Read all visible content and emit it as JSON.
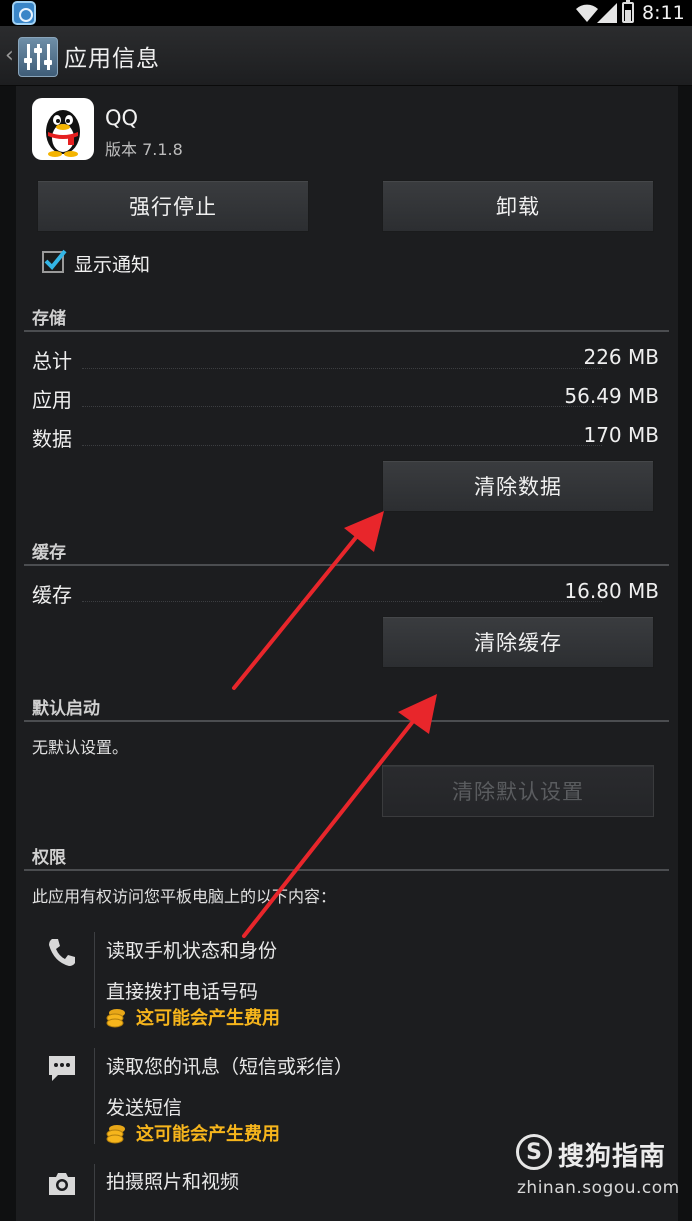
{
  "status_bar": {
    "time": "8:11"
  },
  "action_bar": {
    "title": "应用信息"
  },
  "app": {
    "name": "QQ",
    "version": "版本 7.1.8"
  },
  "buttons": {
    "force_stop": "强行停止",
    "uninstall": "卸载",
    "clear_data": "清除数据",
    "clear_cache": "清除缓存",
    "clear_defaults": "清除默认设置"
  },
  "notification": {
    "label": "显示通知",
    "checked": true
  },
  "storage": {
    "header": "存储",
    "rows": [
      {
        "label": "总计",
        "value": "226 MB"
      },
      {
        "label": "应用",
        "value": "56.49 MB"
      },
      {
        "label": "数据",
        "value": "170 MB"
      }
    ]
  },
  "cache": {
    "header": "缓存",
    "label": "缓存",
    "value": "16.80 MB"
  },
  "default_launch": {
    "header": "默认启动",
    "text": "无默认设置。"
  },
  "permissions": {
    "header": "权限",
    "intro": "此应用有权访问您平板电脑上的以下内容：",
    "groups": [
      {
        "icon": "phone-icon",
        "items": [
          "读取手机状态和身份",
          "直接拨打电话号码"
        ],
        "cost": "这可能会产生费用"
      },
      {
        "icon": "message-icon",
        "items": [
          "读取您的讯息（短信或彩信）",
          "发送短信"
        ],
        "cost": "这可能会产生费用"
      },
      {
        "icon": "camera-icon",
        "items": [
          "拍摄照片和视频"
        ]
      }
    ]
  },
  "watermark": {
    "brand": "搜狗指南",
    "url": "zhinan.sogou.com",
    "logo_letter": "S"
  },
  "colors": {
    "arrow": "#e8262b",
    "cost_text": "#f6b51c",
    "accent_check": "#33b5e5"
  }
}
